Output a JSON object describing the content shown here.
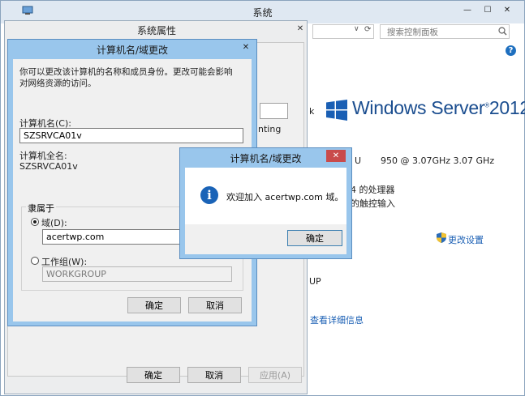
{
  "system_window": {
    "title": "系统",
    "search_placeholder": "搜索控制面板",
    "nav_dropdown_glyph": "∨",
    "nav_refresh_glyph": "⟳",
    "min_glyph": "—",
    "max_glyph": "☐",
    "close_glyph": "✕",
    "help_glyph": "?",
    "partial_label": "k",
    "logo_text": "Windows Server",
    "logo_version": "2012",
    "cpu_fragment": "U",
    "cpu_speed": "950  @ 3.07GHz   3.07 GHz",
    "processor_fragment": "4 的处理器",
    "touch_fragment": "的触控输入",
    "change_settings": "更改设置",
    "up_fragment": "UP",
    "details_link": "查看详细信息"
  },
  "system_properties": {
    "title": "系统属性",
    "close_glyph": "✕",
    "counting_fragment": "nting",
    "ok_label": "确定",
    "cancel_label": "取消",
    "apply_label": "应用(A)"
  },
  "computer_name_dialog": {
    "title": "计算机名/域更改",
    "close_glyph": "✕",
    "description": "你可以更改该计算机的名称和成员身份。更改可能会影响对网络资源的访问。",
    "computer_name_label": "计算机名(C):",
    "computer_name_value": "SZSRVCA01v",
    "full_name_label": "计算机全名:",
    "full_name_value": "SZSRVCA01v",
    "member_of_label": "隶属于",
    "domain_label": "域(D):",
    "domain_value": "acertwp.com",
    "workgroup_label": "工作组(W):",
    "workgroup_value": "WORKGROUP",
    "ok_label": "确定",
    "cancel_label": "取消"
  },
  "welcome_dialog": {
    "title": "计算机名/域更改",
    "close_glyph": "✕",
    "info_glyph": "i",
    "message": "欢迎加入 acertwp.com 域。",
    "ok_label": "确定"
  }
}
